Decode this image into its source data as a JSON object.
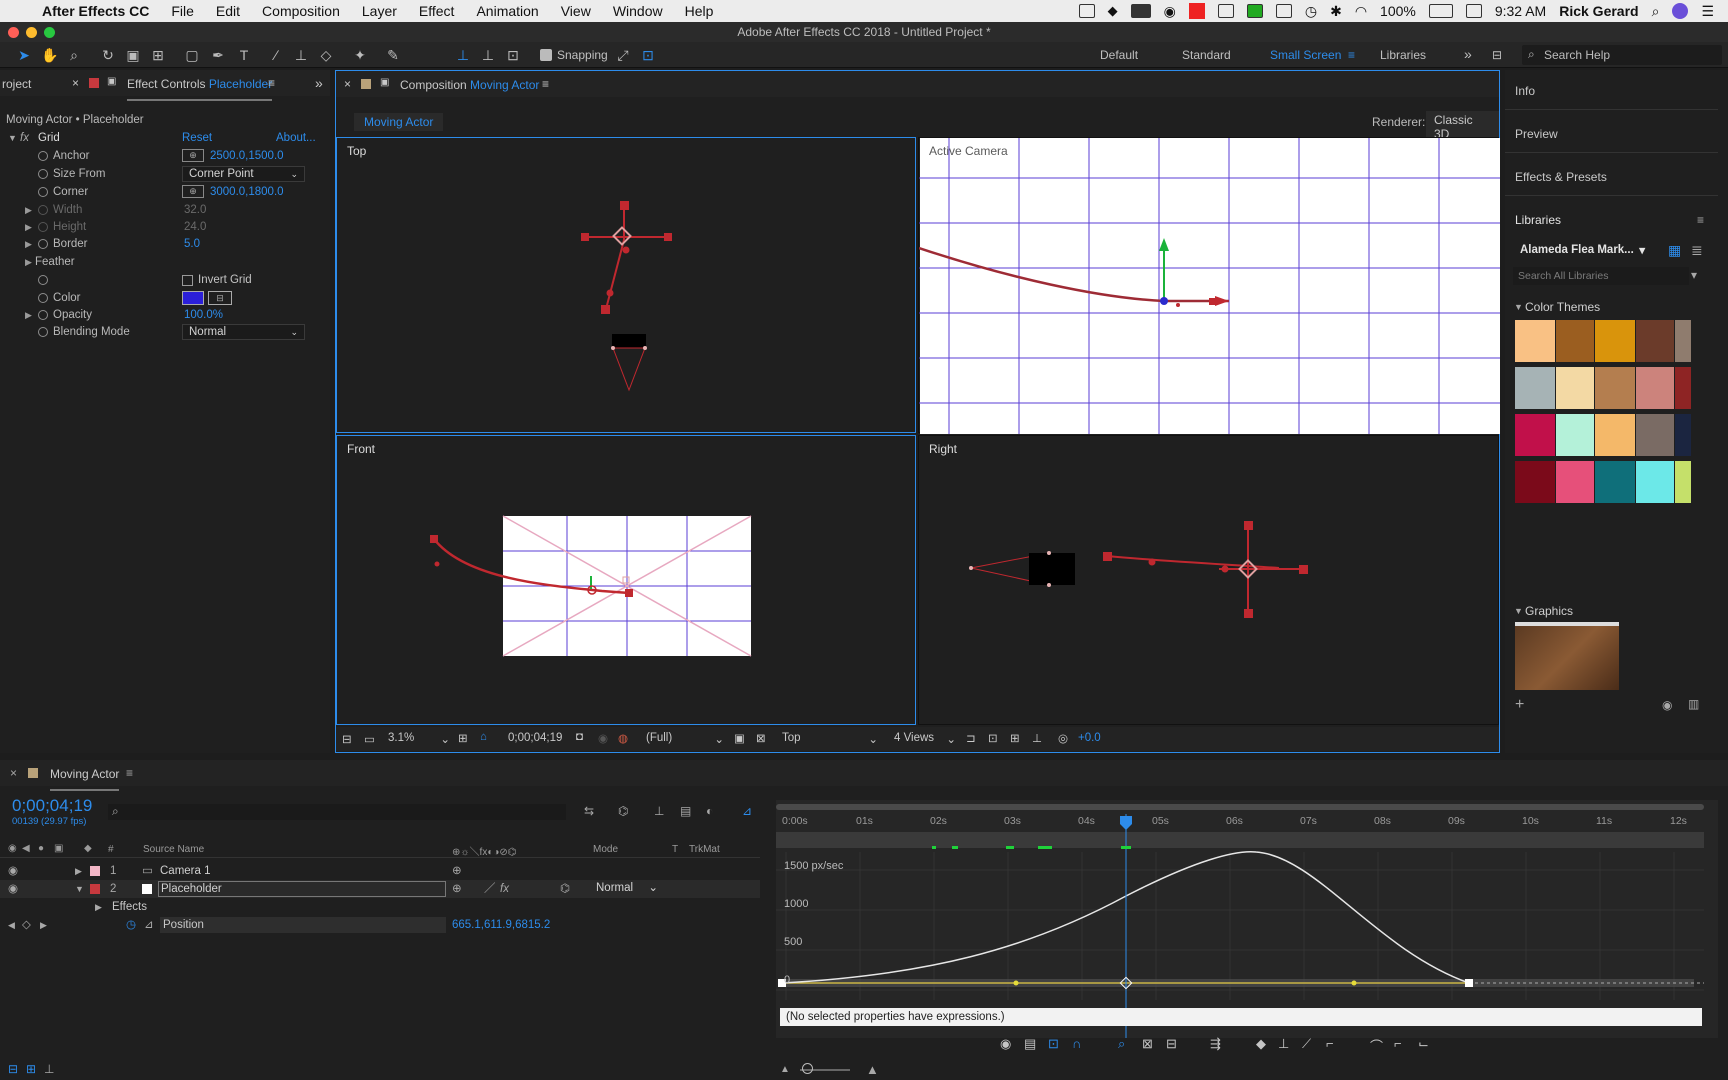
{
  "menubar": {
    "apple": "",
    "app": "After Effects CC",
    "items": [
      "File",
      "Edit",
      "Composition",
      "Layer",
      "Effect",
      "Animation",
      "View",
      "Window",
      "Help"
    ],
    "battery": "100%",
    "time": "9:32 AM",
    "user": "Rick Gerard"
  },
  "window": {
    "title": "Adobe After Effects CC 2018 - Untitled Project *"
  },
  "toolbar": {
    "snapping": "Snapping",
    "workspaces": [
      "Default",
      "Standard",
      "Small Screen",
      "Libraries"
    ],
    "active_workspace": "Small Screen",
    "search_placeholder": "Search Help"
  },
  "effect_controls": {
    "tab_project": "roject",
    "tab_prefix": "Effect Controls",
    "tab_layer": "Placeholder",
    "breadcrumb": "Moving Actor • Placeholder",
    "effect_name": "Grid",
    "reset": "Reset",
    "about": "About...",
    "props": [
      {
        "name": "Anchor",
        "value": "2500.0,1500.0"
      },
      {
        "name": "Size From",
        "value": "Corner Point"
      },
      {
        "name": "Corner",
        "value": "3000.0,1800.0"
      },
      {
        "name": "Width",
        "value": "32.0"
      },
      {
        "name": "Height",
        "value": "24.0"
      },
      {
        "name": "Border",
        "value": "5.0"
      },
      {
        "name": "Feather",
        "value": ""
      },
      {
        "name": "",
        "value": "Invert Grid"
      },
      {
        "name": "Color",
        "value": ""
      },
      {
        "name": "Opacity",
        "value": "100.0%"
      },
      {
        "name": "Blending Mode",
        "value": "Normal"
      }
    ],
    "color_swatch": "#2b1fd9"
  },
  "composition": {
    "tab_prefix": "Composition",
    "tab_name": "Moving Actor",
    "comp_chip": "Moving Actor",
    "renderer_label": "Renderer:",
    "renderer": "Classic 3D",
    "views": [
      "Top",
      "Active Camera",
      "Front",
      "Right"
    ],
    "footer": {
      "zoom": "3.1%",
      "timecode": "0;00;04;19",
      "resolution": "(Full)",
      "view": "Top",
      "layout": "4 Views",
      "exposure": "+0.0"
    }
  },
  "right_panel": {
    "items": [
      "Info",
      "Preview",
      "Effects & Presets",
      "Libraries"
    ],
    "library_name": "Alameda Flea Mark...",
    "search_placeholder": "Search All Libraries",
    "color_themes": "Color Themes",
    "graphics": "Graphics",
    "themes": [
      [
        "#f9c184",
        "#9b5e20",
        "#d9940c",
        "#6b3b2a",
        "#8f7c6e"
      ],
      [
        "#a6b3b5",
        "#f3d9a4",
        "#b47e4f",
        "#cc837c",
        "#8e2424"
      ],
      [
        "#c1104a",
        "#b4f1d9",
        "#f4b869",
        "#7a6b64",
        "#1b2540"
      ],
      [
        "#7b0a1a",
        "#e6507a",
        "#0f6f7a",
        "#6ce8e8",
        "#c5e06a"
      ]
    ]
  },
  "timeline": {
    "comp_name": "Moving Actor",
    "timecode": "0;00;04;19",
    "frame_info": "00139 (29.97 fps)",
    "headers": {
      "num": "#",
      "source": "Source Name",
      "mode": "Mode",
      "t": "T",
      "trkmat": "TrkMat"
    },
    "layers": [
      {
        "num": "1",
        "name": "Camera 1",
        "color": "#f2b6c6"
      },
      {
        "num": "2",
        "name": "Placeholder",
        "color": "#c7393e",
        "mode": "Normal"
      }
    ],
    "effects_label": "Effects",
    "position_label": "Position",
    "position_value": "665.1,611.9,6815.2",
    "ruler": [
      "0:00s",
      "01s",
      "02s",
      "03s",
      "04s",
      "05s",
      "06s",
      "07s",
      "08s",
      "09s",
      "10s",
      "11s",
      "12s"
    ],
    "graph_labels": [
      "1500 px/sec",
      "1000",
      "500",
      "0"
    ],
    "expression_msg": "(No selected properties have expressions.)"
  }
}
